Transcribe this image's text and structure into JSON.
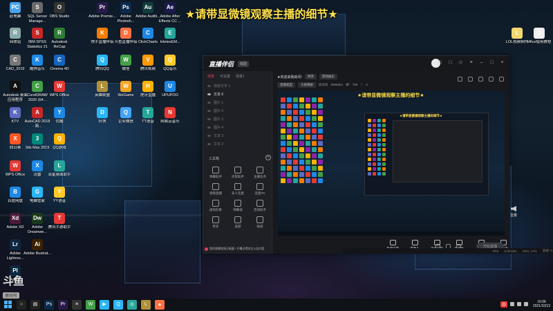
{
  "banner": {
    "text": "★请带显微镜观察主播的细节★"
  },
  "desktop_icons": [
    {
      "label": "此电脑",
      "glyph": "PC",
      "color": "#4aa3e8"
    },
    {
      "label": "SQL Server Manage...",
      "glyph": "S",
      "color": "#6a6a6a"
    },
    {
      "label": "OBS Studio",
      "glyph": "O",
      "color": "#333333"
    },
    {
      "label": "Adobe Premie...",
      "glyph": "Pr",
      "color": "#2a1a4a"
    },
    {
      "label": "Adobe Photosh...",
      "glyph": "Ps",
      "color": "#0b2a4a"
    },
    {
      "label": "Adobe Auditi...",
      "glyph": "Au",
      "color": "#123c3c"
    },
    {
      "label": "Adobe After Effects CC ...",
      "glyph": "Ae",
      "color": "#1c1a4a"
    },
    {
      "label": "回收站",
      "glyph": "R",
      "color": "#8aa"
    },
    {
      "label": "IBM SPSS Statistics 21",
      "glyph": "S",
      "color": "#c62828"
    },
    {
      "label": "Autodesk ReCap",
      "glyph": "R",
      "color": "#2e7d32"
    },
    {
      "label": "快手直播伴侣",
      "glyph": "K",
      "color": "#f57c00"
    },
    {
      "label": "斗鱼直播伴侣",
      "glyph": "D",
      "color": "#ff7043"
    },
    {
      "label": "ClickCharts",
      "glyph": "C",
      "color": "#1e88e5"
    },
    {
      "label": "InletexEM...",
      "glyph": "E",
      "color": "#26a69a"
    },
    {
      "label": "CAD_2019",
      "glyph": "C",
      "color": "#777"
    },
    {
      "label": "酷狗音乐",
      "glyph": "K",
      "color": "#1e88e5"
    },
    {
      "label": "Cinema 4D",
      "glyph": "C",
      "color": "#1565c0"
    },
    {
      "label": "腾讯QQ",
      "glyph": "Q",
      "color": "#29b6f6"
    },
    {
      "label": "微信",
      "glyph": "W",
      "color": "#43a047"
    },
    {
      "label": "腾讯视频",
      "glyph": "V",
      "color": "#ff9800"
    },
    {
      "label": "QQ音乐",
      "glyph": "Q",
      "color": "#ffca28"
    },
    {
      "label": "Autodesk 桌面应用程序",
      "glyph": "A",
      "color": "#111"
    },
    {
      "label": "CorelDRAW 2020 (64...",
      "glyph": "C",
      "color": "#43a047"
    },
    {
      "label": "WPS Office",
      "glyph": "W",
      "color": "#e53935"
    },
    {
      "label": "英雄联盟",
      "glyph": "L",
      "color": "#b0903a"
    },
    {
      "label": "WeGame",
      "glyph": "W",
      "color": "#f5a623"
    },
    {
      "label": "虎牙直播",
      "glyph": "H",
      "color": "#ffb300"
    },
    {
      "label": "UPUPOO",
      "glyph": "U",
      "color": "#1e88e5"
    },
    {
      "label": "KTV",
      "glyph": "K",
      "color": "#5c6bc0"
    },
    {
      "label": "AutoCAD 2018 - 简...",
      "glyph": "A",
      "color": "#c62828"
    },
    {
      "label": "优酷",
      "glyph": "Y",
      "color": "#1e88e5"
    },
    {
      "label": "抖快",
      "glyph": "D",
      "color": "#29b6f6"
    },
    {
      "label": "企业微信",
      "glyph": "Q",
      "color": "#42a5f5"
    },
    {
      "label": "TT语音",
      "glyph": "T",
      "color": "#26a69a"
    },
    {
      "label": "网易云音乐",
      "glyph": "N",
      "color": "#e53935"
    },
    {
      "label": "向日葵",
      "glyph": "X",
      "color": "#ff5722"
    },
    {
      "label": "3ds Max 2019",
      "glyph": "3",
      "color": "#00897b"
    },
    {
      "label": "QQ游戏",
      "glyph": "Q",
      "color": "#ffb300"
    },
    {
      "label": "WPS Office",
      "glyph": "W",
      "color": "#e53935"
    },
    {
      "label": "迅雷",
      "glyph": "X",
      "color": "#1e88e5"
    },
    {
      "label": "流星桌面助手",
      "glyph": "L",
      "color": "#26a69a"
    },
    {
      "label": "百度网盘",
      "glyph": "B",
      "color": "#1e88e5"
    },
    {
      "label": "电脑管家",
      "glyph": "G",
      "color": "#29b6f6"
    },
    {
      "label": "YY语音",
      "glyph": "Y",
      "color": "#ffca28"
    },
    {
      "label": "Adobe XD",
      "glyph": "Xd",
      "color": "#4a1a3a"
    },
    {
      "label": "Adobe Dreamwe...",
      "glyph": "Dw",
      "color": "#1b3a1b"
    },
    {
      "label": "腾讯手游助手",
      "glyph": "T",
      "color": "#e53935"
    },
    {
      "label": "Adobe Lightroo...",
      "glyph": "Lr",
      "color": "#0d2740"
    },
    {
      "label": "Adobe Illustrat...",
      "glyph": "Ai",
      "color": "#3a2200"
    },
    {
      "label": "Adobe",
      "glyph": "Pl",
      "color": "#0d2740"
    },
    {
      "label": "LOL视频制作",
      "glyph": "L",
      "color": "#f5d76e"
    },
    {
      "label": "office使用教程",
      "glyph": "O",
      "color": "#eeeeee"
    }
  ],
  "app": {
    "logo": "直播伴侣",
    "edition": "体验",
    "scene_tabs": [
      {
        "label": "场景",
        "active": true
      },
      {
        "label": "可设置",
        "active": false
      },
      {
        "label": "场景1",
        "active": false
      }
    ],
    "scenes": [
      {
        "label": "场景文字 1",
        "active": false
      },
      {
        "label": "文本 6",
        "active": true
      },
      {
        "label": "图片 1",
        "active": false
      },
      {
        "label": "图片 2",
        "active": false
      },
      {
        "label": "图片 3",
        "active": false
      },
      {
        "label": "图片 4",
        "active": false
      },
      {
        "label": "文本 3",
        "active": false
      },
      {
        "label": "文本 2",
        "active": false
      }
    ],
    "tools_title": "工具箱",
    "tools_add": "+",
    "tools": [
      {
        "label": "弹幕助手"
      },
      {
        "label": "房管助手"
      },
      {
        "label": "主播任务"
      },
      {
        "label": "视频直播"
      },
      {
        "label": "多人连麦"
      },
      {
        "label": "连麦PK"
      },
      {
        "label": "虚拟形象"
      },
      {
        "label": "弹幕墙"
      },
      {
        "label": "音效助手"
      },
      {
        "label": "更多"
      },
      {
        "label": "美颜"
      },
      {
        "label": "贴纸"
      }
    ],
    "notice": "您的直播发扬正能量 / 开播记得关注公告内容",
    "room_title": "★欢迎来我房间!",
    "chip_edit": "修改",
    "chip_category": "游戏娱乐",
    "category_tags": [
      "直播类型",
      "大屏横屏"
    ],
    "room_id_label": "房间号",
    "room_id": "9985652",
    "viewer_count": "799",
    "like_count": "2",
    "preview_banner": "★请带显微镜观察主播的细节★",
    "nested_banner": "★请带显微镜观察主播的细节★",
    "controls": [
      {
        "label": "直播屏幕",
        "icon": "screen-icon"
      },
      {
        "label": "摄像头",
        "icon": "camera-icon"
      },
      {
        "label": "手机投屏",
        "icon": "phone-icon"
      },
      {
        "label": "多媒体",
        "icon": "media-icon"
      },
      {
        "label": "麦克风",
        "icon": "mic-icon"
      },
      {
        "label": "扬声器",
        "icon": "speaker-icon"
      }
    ],
    "live_button": "开始直播",
    "status": [
      "FPS",
      "0.00 kb/s",
      "CPU: 17%",
      "丢帧: 0.0%",
      "00:00:00"
    ]
  },
  "ext_volume_label": "音量",
  "watermark": {
    "logo": "斗鱼",
    "tag": "房间号",
    "room_id": "9985652"
  },
  "taskbar": {
    "apps": [
      {
        "glyph": "○",
        "color": "#222"
      },
      {
        "glyph": "▤",
        "color": "#222"
      },
      {
        "glyph": "Ps",
        "color": "#0b2a4a"
      },
      {
        "glyph": "Pr",
        "color": "#2a1a4a"
      },
      {
        "glyph": "≡",
        "color": "#333"
      },
      {
        "glyph": "W",
        "color": "#43a047"
      },
      {
        "glyph": "▶",
        "color": "#29b6f6"
      },
      {
        "glyph": "Q",
        "color": "#29b6f6"
      },
      {
        "glyph": "◎",
        "color": "#26a69a"
      },
      {
        "glyph": "L",
        "color": "#b0903a"
      },
      {
        "glyph": "▲",
        "color": "#ff7043"
      }
    ],
    "ime": "中",
    "time": "16:06",
    "date": "2021/10/13"
  }
}
